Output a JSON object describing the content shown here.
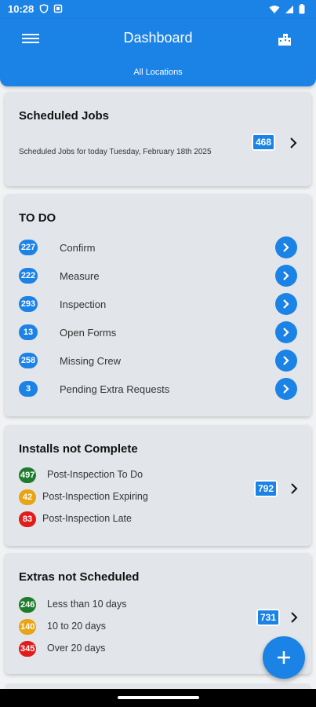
{
  "status_bar": {
    "time": "10:28"
  },
  "app_bar": {
    "title": "Dashboard",
    "subtitle": "All Locations"
  },
  "scheduled_jobs": {
    "title": "Scheduled Jobs",
    "description": "Scheduled Jobs for today Tuesday, February 18th 2025",
    "count": "468"
  },
  "todo": {
    "title": "TO DO",
    "items": [
      {
        "count": "227",
        "label": "Confirm"
      },
      {
        "count": "222",
        "label": "Measure"
      },
      {
        "count": "293",
        "label": "Inspection"
      },
      {
        "count": "13",
        "label": "Open Forms"
      },
      {
        "count": "258",
        "label": "Missing Crew"
      },
      {
        "count": "3",
        "label": "Pending Extra Requests"
      }
    ]
  },
  "installs_not_complete": {
    "title": "Installs not Complete",
    "total": "792",
    "items": [
      {
        "count": "497",
        "label": "Post-Inspection To Do",
        "color": "#1e7d2d"
      },
      {
        "count": "42",
        "label": "Post-Inspection Expiring",
        "color": "#e8a413"
      },
      {
        "count": "83",
        "label": "Post-Inspection Late",
        "color": "#e21b1b"
      }
    ]
  },
  "extras_not_scheduled": {
    "title": "Extras not Scheduled",
    "total": "731",
    "items": [
      {
        "count": "246",
        "label": "Less than 10 days",
        "color": "#1e7d2d"
      },
      {
        "count": "140",
        "label": "10 to 20 days",
        "color": "#e8a413"
      },
      {
        "count": "345",
        "label": "Over 20 days",
        "color": "#e21b1b"
      }
    ]
  },
  "colors": {
    "primary": "#1b82e6",
    "card": "#e2e6ea"
  }
}
